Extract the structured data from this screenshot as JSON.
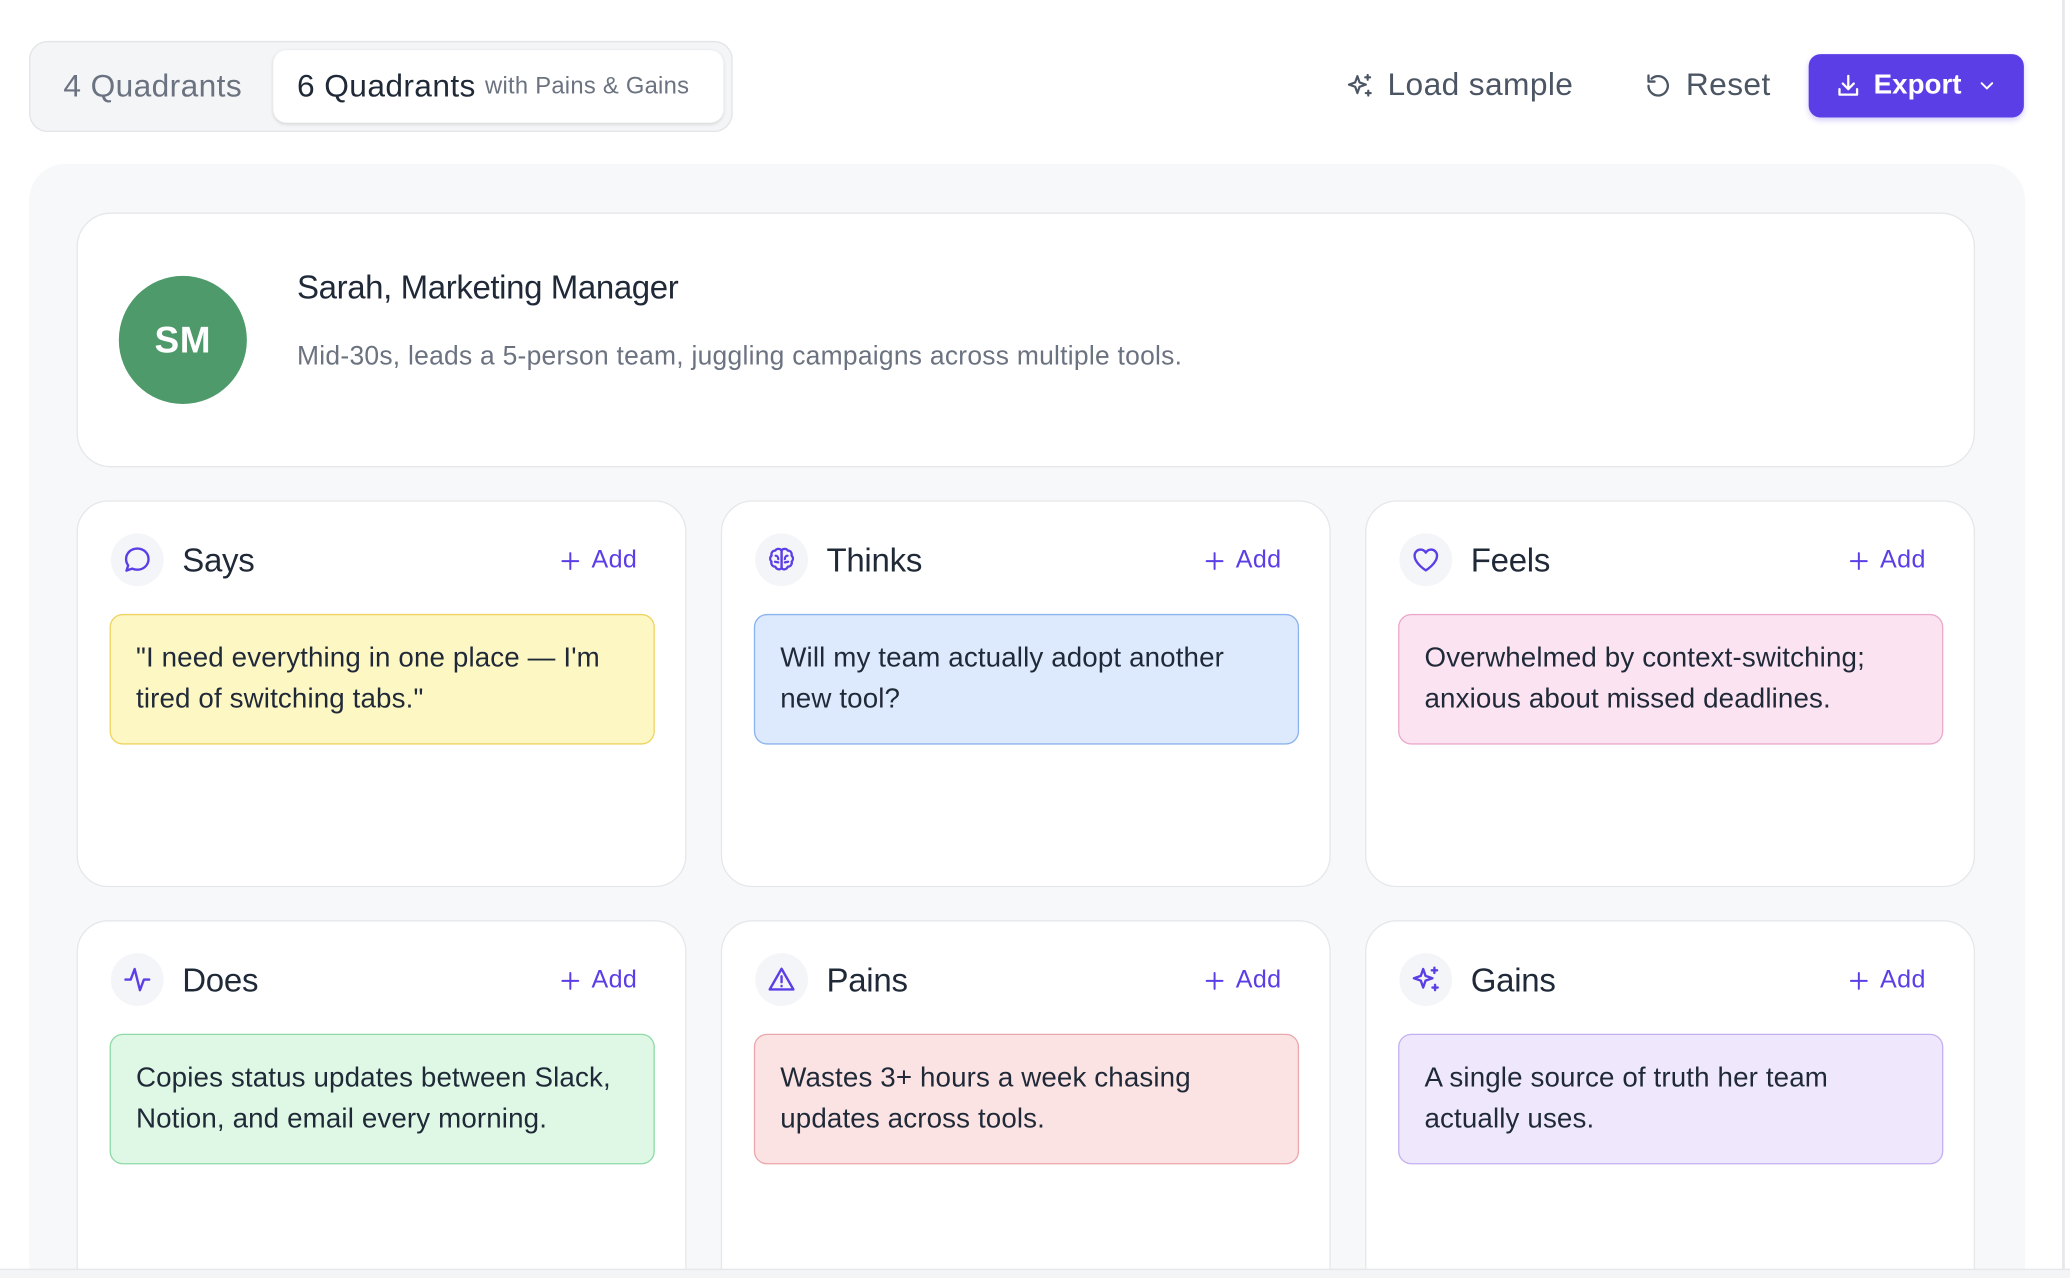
{
  "toolbar": {
    "mode_four_label": "4 Quadrants",
    "mode_six_label": "6 Quadrants",
    "mode_six_sub": "with Pains & Gains",
    "load_sample_label": "Load sample",
    "reset_label": "Reset",
    "export_label": "Export"
  },
  "persona": {
    "initials": "SM",
    "name": "Sarah, Marketing Manager",
    "description": "Mid-30s, leads a 5-person team, juggling campaigns across multiple tools.",
    "avatar_color": "#4e9a6a"
  },
  "add_label": "Add",
  "quadrants": [
    {
      "key": "says",
      "title": "Says",
      "icon": "speech-bubble-icon",
      "notes": [
        "\"I need everything in one place — I'm tired of switching tabs.\""
      ]
    },
    {
      "key": "thinks",
      "title": "Thinks",
      "icon": "brain-icon",
      "notes": [
        "Will my team actually adopt another new tool?"
      ]
    },
    {
      "key": "feels",
      "title": "Feels",
      "icon": "heart-icon",
      "notes": [
        "Overwhelmed by context-switching; anxious about missed deadlines."
      ]
    },
    {
      "key": "does",
      "title": "Does",
      "icon": "activity-icon",
      "notes": [
        "Copies status updates between Slack, Notion, and email every morning."
      ]
    },
    {
      "key": "pains",
      "title": "Pains",
      "icon": "warning-triangle-icon",
      "notes": [
        "Wastes 3+ hours a week chasing updates across tools."
      ]
    },
    {
      "key": "gains",
      "title": "Gains",
      "icon": "sparkles-icon",
      "notes": [
        "A single source of truth her team actually uses."
      ]
    }
  ],
  "colors": {
    "accent": "#5b3ee6",
    "says_note": "#fdf7c4",
    "thinks_note": "#dde9fd",
    "feels_note": "#fbe3f2",
    "does_note": "#dff8e6",
    "pains_note": "#fbe3e4",
    "gains_note": "#efe8fd"
  }
}
